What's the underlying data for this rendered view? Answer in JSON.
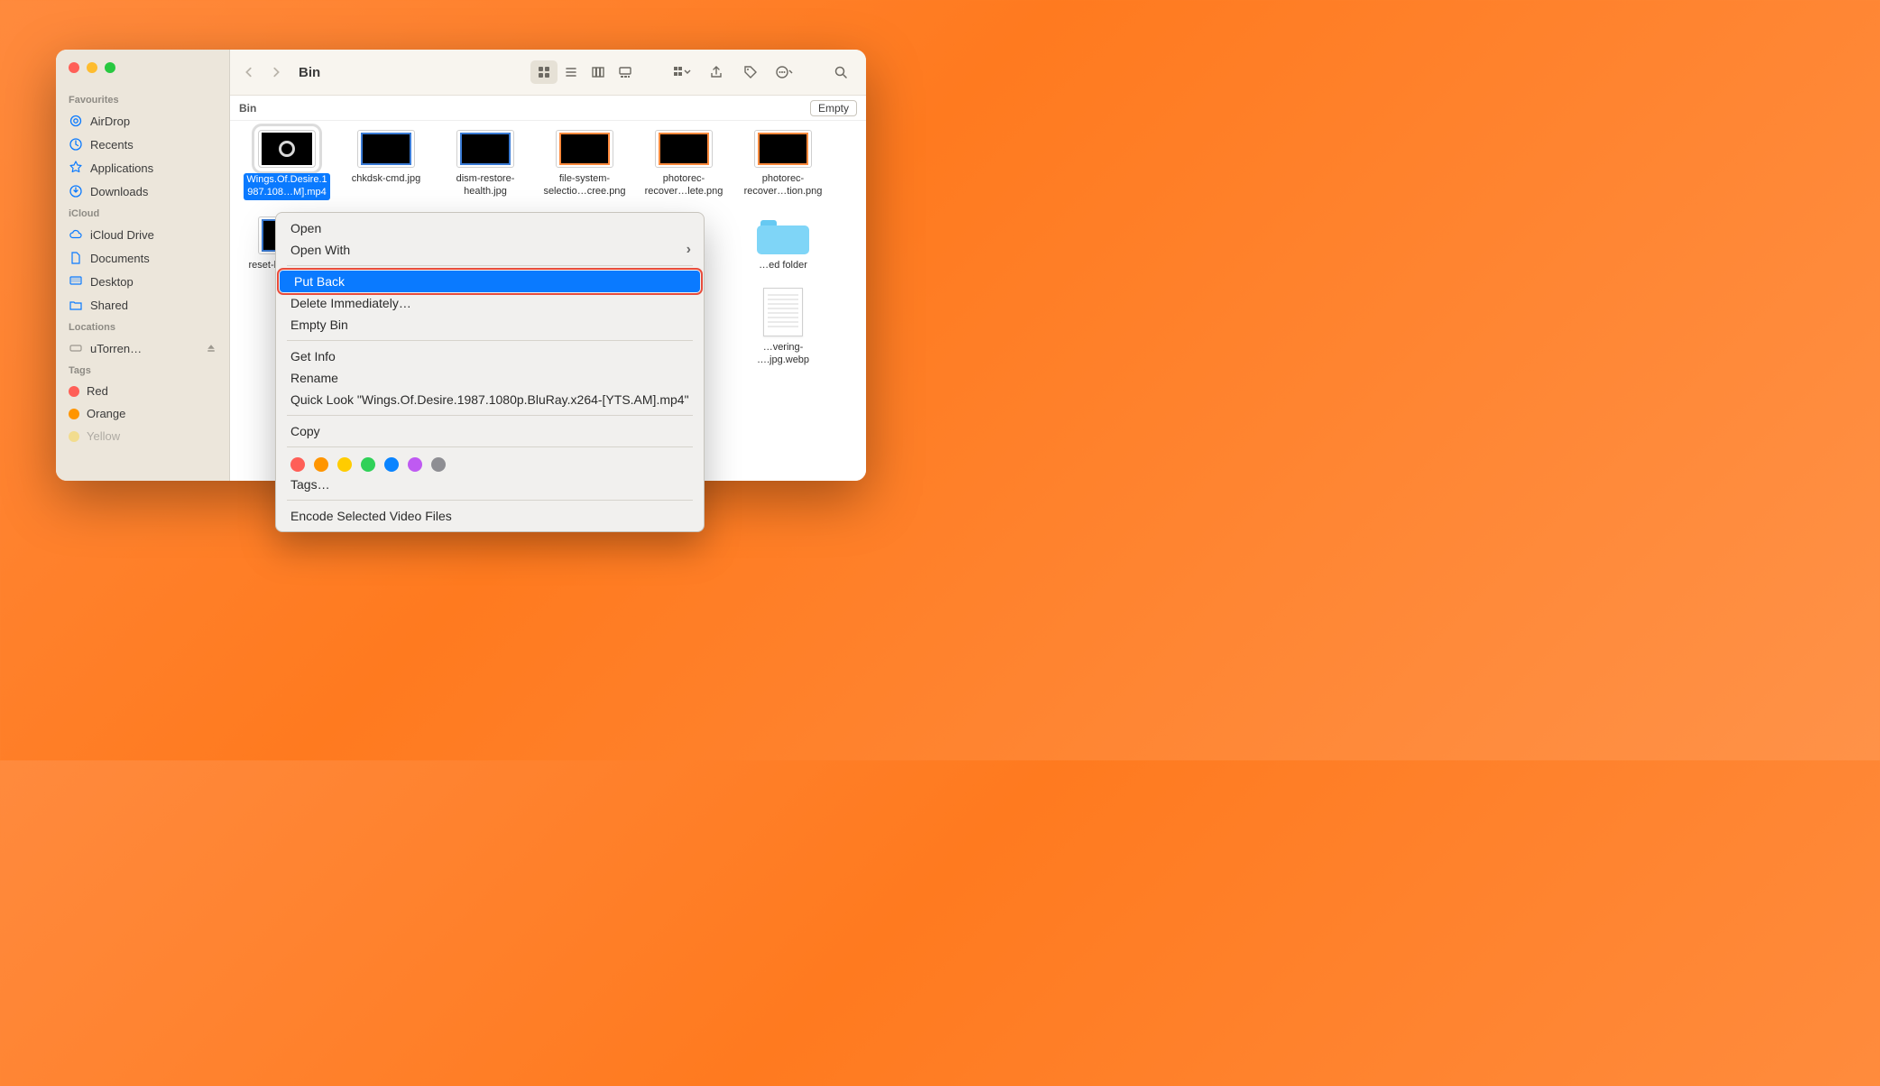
{
  "window": {
    "title": "Bin"
  },
  "pathbar": {
    "location": "Bin",
    "empty_label": "Empty"
  },
  "sidebar": {
    "sections": [
      {
        "heading": "Favourites",
        "items": [
          {
            "label": "AirDrop"
          },
          {
            "label": "Recents"
          },
          {
            "label": "Applications"
          },
          {
            "label": "Downloads"
          }
        ]
      },
      {
        "heading": "iCloud",
        "items": [
          {
            "label": "iCloud Drive"
          },
          {
            "label": "Documents"
          },
          {
            "label": "Desktop"
          },
          {
            "label": "Shared"
          }
        ]
      },
      {
        "heading": "Locations",
        "items": [
          {
            "label": "uTorren…"
          }
        ]
      },
      {
        "heading": "Tags",
        "items": [
          {
            "label": "Red",
            "color": "#ff5f57"
          },
          {
            "label": "Orange",
            "color": "#ff9500"
          },
          {
            "label": "Yellow",
            "color": "#ffcc00"
          }
        ]
      }
    ]
  },
  "files": {
    "row1": [
      {
        "label_l1": "Wings.Of.Desire.1",
        "label_l2": "987.108…M].mp4",
        "selected": true,
        "kind": "video"
      },
      {
        "label_l1": "chkdsk-cmd.jpg",
        "label_l2": "",
        "kind": "img-blue"
      },
      {
        "label_l1": "dism-restore-",
        "label_l2": "health.jpg",
        "kind": "img-blue"
      },
      {
        "label_l1": "file-system-",
        "label_l2": "selectio…cree.png",
        "kind": "img-orange"
      },
      {
        "label_l1": "photorec-",
        "label_l2": "recover…lete.png",
        "kind": "img-orange"
      },
      {
        "label_l1": "photorec-",
        "label_l2": "recover…tion.png",
        "kind": "img-orange"
      }
    ],
    "row2": [
      {
        "label_l1": "reset-bin-cmd.jpg",
        "label_l2": "",
        "kind": "img-blue"
      },
      {
        "label_l1": "…ed folder",
        "label_l2": "",
        "kind": "folder"
      },
      {
        "label_l1": "…vering-",
        "label_l2": "….jpg.webp",
        "kind": "doc"
      }
    ]
  },
  "context_menu": {
    "open": "Open",
    "open_with": "Open With",
    "put_back": "Put Back",
    "delete_immediately": "Delete Immediately…",
    "empty_bin": "Empty Bin",
    "get_info": "Get Info",
    "rename": "Rename",
    "quick_look": "Quick Look \"Wings.Of.Desire.1987.1080p.BluRay.x264-[YTS.AM].mp4\"",
    "copy": "Copy",
    "tags": "Tags…",
    "encode": "Encode Selected Video Files",
    "tag_colors": [
      "#ff5f57",
      "#ff9500",
      "#ffcc00",
      "#30d158",
      "#0a84ff",
      "#bf5af2",
      "#8e8e93"
    ]
  }
}
